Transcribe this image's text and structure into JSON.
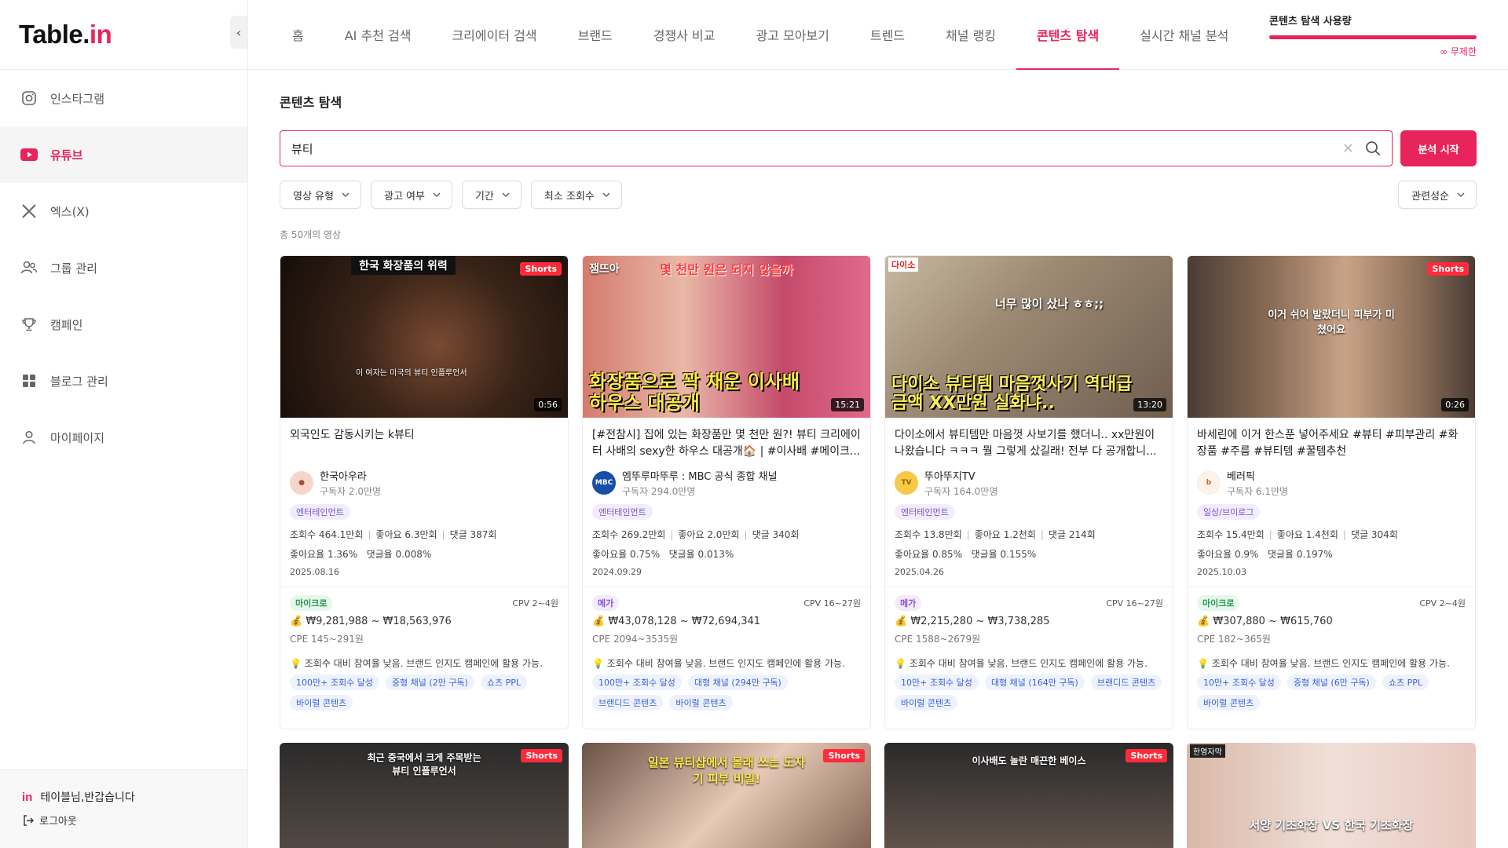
{
  "logo": {
    "text": "Table.",
    "accent": "in"
  },
  "sidebar": {
    "items": [
      {
        "label": "인스타그램",
        "icon": "instagram-icon"
      },
      {
        "label": "유튜브",
        "icon": "youtube-icon"
      },
      {
        "label": "엑스(X)",
        "icon": "x-icon"
      },
      {
        "label": "그룹 관리",
        "icon": "group-icon"
      },
      {
        "label": "캠페인",
        "icon": "trophy-icon"
      },
      {
        "label": "블로그 관리",
        "icon": "grid-icon"
      },
      {
        "label": "마이페이지",
        "icon": "user-icon"
      }
    ],
    "greeting": "테이블님,반갑습니다",
    "greeting_logo": "in",
    "logout": "로그아웃"
  },
  "topnav": {
    "tabs": [
      "홈",
      "AI 추천 검색",
      "크리에이터 검색",
      "브랜드",
      "경쟁사 비교",
      "광고 모아보기",
      "트렌드",
      "채널 랭킹",
      "콘텐츠 탐색",
      "실시간 채널 분석"
    ],
    "active": "콘텐츠 탐색",
    "usage_title": "콘텐츠 탐색 사용량",
    "usage_value": "∞ 무제한",
    "usage_fraction": 1.0
  },
  "page": {
    "title": "콘텐츠 탐색",
    "search_value": "뷰티",
    "search_button": "분석 시작",
    "filters": [
      "영상 유형",
      "광고 여부",
      "기간",
      "최소 조회수"
    ],
    "sort": "관련성순",
    "total": "총 50개의 영상"
  },
  "cards": [
    {
      "thumb_caption": "한국 화장품의 위력",
      "thumb_sub": "이 여자는 미국의 뷰티 인플루언서",
      "thumb_big": "",
      "shorts": "Shorts",
      "duration": "0:56",
      "title": "외국인도 감동시키는 k뷰티",
      "channel": "한국아우라",
      "subs": "구독자 2.0만명",
      "category": "엔터테인먼트",
      "stats": [
        "조회수 464.1만회",
        "좋아요 6.3만회",
        "댓글 387회"
      ],
      "like_rate": "좋아요율 1.36%",
      "comment_rate": "댓글율 0.008%",
      "date": "2025.08.16",
      "tier": "마이크로",
      "tier_type": "micro",
      "cpv": "CPV 2~4원",
      "price": "₩9,281,988 ~ ₩18,563,976",
      "cpe": "CPE 145~291원",
      "insight": "조회수 대비 참여율 낮음. 브랜드 인지도 캠페인에 활용 가능.",
      "tags": [
        "100만+ 조회수 달성",
        "중형 채널 (2만 구독)",
        "쇼츠 PPL",
        "바이럴 콘텐츠"
      ]
    },
    {
      "thumb_caption": "몇 천만 원은 되지 않을까",
      "thumb_sub": "잼뜨아",
      "thumb_big": "화장품으로 꽉 채운 이사배 하우스 대공개",
      "shorts": "",
      "duration": "15:21",
      "title": "[#전참시] 집에 있는 화장품만 몇 천만 원?! 뷰티 크리에이터 사배의 sexy한 하우스 대공개🏠 | #이사배 #메이크...",
      "channel": "엠뚜루마뚜루 : MBC 공식 종합 채널",
      "subs": "구독자 294.0만명",
      "category": "엔터테인먼트",
      "stats": [
        "조회수 269.2만회",
        "좋아요 2.0만회",
        "댓글 340회"
      ],
      "like_rate": "좋아요율 0.75%",
      "comment_rate": "댓글율 0.013%",
      "date": "2024.09.29",
      "tier": "메가",
      "tier_type": "mega",
      "cpv": "CPV 16~27원",
      "price": "₩43,078,128 ~ ₩72,694,341",
      "cpe": "CPE 2094~3535원",
      "insight": "조회수 대비 참여율 낮음. 브랜드 인지도 캠페인에 활용 가능.",
      "tags": [
        "100만+ 조회수 달성",
        "대형 채널 (294만 구독)",
        "브랜디드 콘텐츠",
        "바이럴 콘텐츠"
      ]
    },
    {
      "thumb_caption": "다이소",
      "thumb_sub": "너무 많이 샀나 ㅎㅎ;;",
      "thumb_big": "다이소 뷰티템 마음껏사기 역대급 금액 XX만원 실화냐..",
      "shorts": "",
      "duration": "13:20",
      "title": "다이소에서 뷰티템만 마음껏 사보기를 했더니.. xx만원이 나왔습니다 ㅋㅋㅋ 뭘 그렇게 샀길래! 전부 다 공개합니...",
      "channel": "뚜아뚜지TV",
      "subs": "구독자 164.0만명",
      "category": "엔터테인먼트",
      "stats": [
        "조회수 13.8만회",
        "좋아요 1.2천회",
        "댓글 214회"
      ],
      "like_rate": "좋아요율 0.85%",
      "comment_rate": "댓글율 0.155%",
      "date": "2025.04.26",
      "tier": "메가",
      "tier_type": "mega",
      "cpv": "CPV 16~27원",
      "price": "₩2,215,280 ~ ₩3,738,285",
      "cpe": "CPE 1588~2679원",
      "insight": "조회수 대비 참여율 낮음. 브랜드 인지도 캠페인에 활용 가능.",
      "tags": [
        "10만+ 조회수 달성",
        "대형 채널 (164만 구독)",
        "브랜디드 콘텐츠",
        "바이럴 콘텐츠"
      ]
    },
    {
      "thumb_caption": "이거 쉬어 발랐더니 피부가 미쳤어요",
      "thumb_sub": "",
      "thumb_big": "",
      "shorts": "Shorts",
      "duration": "0:26",
      "title": "바세린에 이거 한스푼 넣어주세요 #뷰티 #피부관리 #화장품 #주름 #뷰티템 #꿀템추천",
      "channel": "베러픽",
      "subs": "구독자 6.1만명",
      "category": "일상/브이로그",
      "stats": [
        "조회수 15.4만회",
        "좋아요 1.4천회",
        "댓글 304회"
      ],
      "like_rate": "좋아요율 0.9%",
      "comment_rate": "댓글율 0.197%",
      "date": "2025.10.03",
      "tier": "마이크로",
      "tier_type": "micro",
      "cpv": "CPV 2~4원",
      "price": "₩307,880 ~ ₩615,760",
      "cpe": "CPE 182~365원",
      "insight": "조회수 대비 참여율 낮음. 브랜드 인지도 캠페인에 활용 가능.",
      "tags": [
        "10만+ 조회수 달성",
        "중형 채널 (6만 구독)",
        "쇼츠 PPL",
        "바이럴 콘텐츠"
      ]
    }
  ],
  "cards_row2": [
    {
      "caption": "최근 중국에서 크게 주목받는 뷰티 인플루언서",
      "shorts": "Shorts"
    },
    {
      "caption": "일본 뷰티샵에서 몰래 쓰는 도자기 피부 비밀!",
      "shorts": "Shorts"
    },
    {
      "caption": "이사배도 놀란 매끈한 베이스",
      "shorts": "Shorts"
    },
    {
      "caption": "서양 기초화장 VS 한국 기초화장",
      "shorts": "한영자막"
    }
  ]
}
